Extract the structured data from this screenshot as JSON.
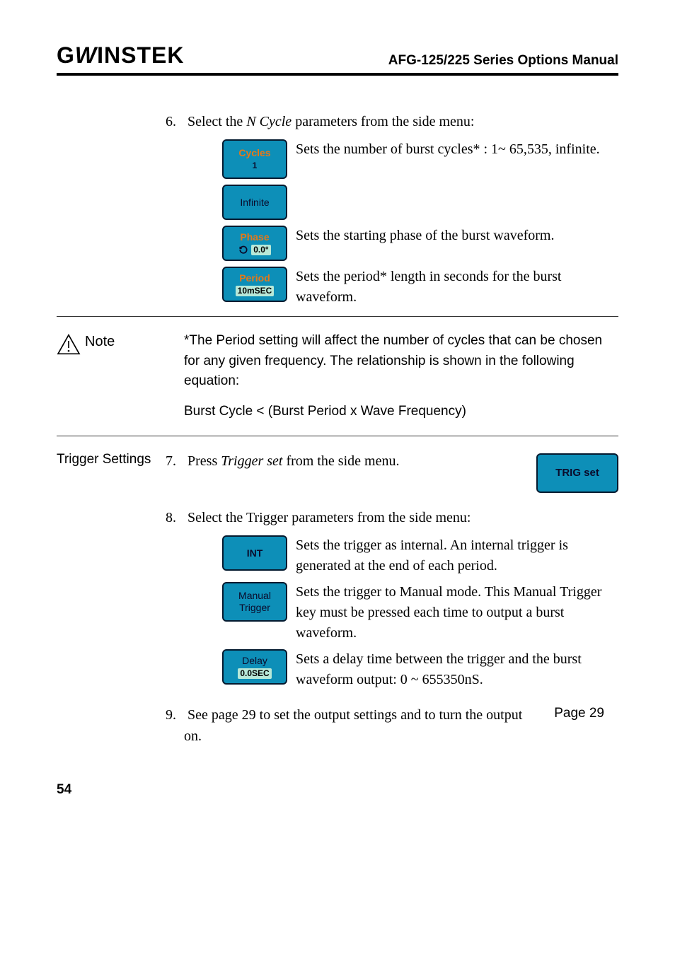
{
  "header": {
    "logo_text": "GWINSTEK",
    "title": "AFG-125/225 Series Options Manual"
  },
  "step6": {
    "num": "6.",
    "intro_a": "Select the ",
    "intro_i": "N Cycle",
    "intro_b": " parameters from the side menu:",
    "btn_cycles_label": "Cycles",
    "btn_cycles_value": "1",
    "btn_infinite": "Infinite",
    "desc_cycles": "Sets the number of burst cycles* : 1~ 65,535, infinite.",
    "btn_phase_label": "Phase",
    "btn_phase_value": "0.0°",
    "desc_phase": "Sets the starting phase of the burst waveform.",
    "btn_period_label": "Period",
    "btn_period_value": "10mSEC",
    "desc_period": "Sets the period* length in seconds for the burst waveform."
  },
  "note": {
    "label": "Note",
    "text1": "*The Period setting will affect the number of cycles that can be chosen for any given frequency. The relationship is shown in the following equation:",
    "text2": "Burst Cycle < (Burst Period x Wave Frequency)"
  },
  "trigger": {
    "label": "Trigger Settings",
    "step7_num": "7.",
    "step7_a": "Press ",
    "step7_i": "Trigger set",
    "step7_b": " from the side menu.",
    "btn_trigset": "TRIG set",
    "step8_num": "8.",
    "step8_text": "Select the Trigger parameters from the side menu:",
    "btn_int": "INT",
    "desc_int": "Sets the trigger as internal. An internal trigger is generated at the end of each period.",
    "btn_manual_l1": "Manual",
    "btn_manual_l2": "Trigger",
    "desc_manual": "Sets the trigger to Manual mode. This Manual Trigger key must be pressed each time to output a burst waveform.",
    "btn_delay_label": "Delay",
    "btn_delay_value": "0.0SEC",
    "desc_delay": "Sets a delay time between the trigger and the burst waveform output: 0 ~ 655350nS.",
    "step9_num": "9.",
    "step9_text": "See page 29 to set the output settings and to turn the output on.",
    "page_ref": "Page 29"
  },
  "footer": {
    "page": "54"
  }
}
